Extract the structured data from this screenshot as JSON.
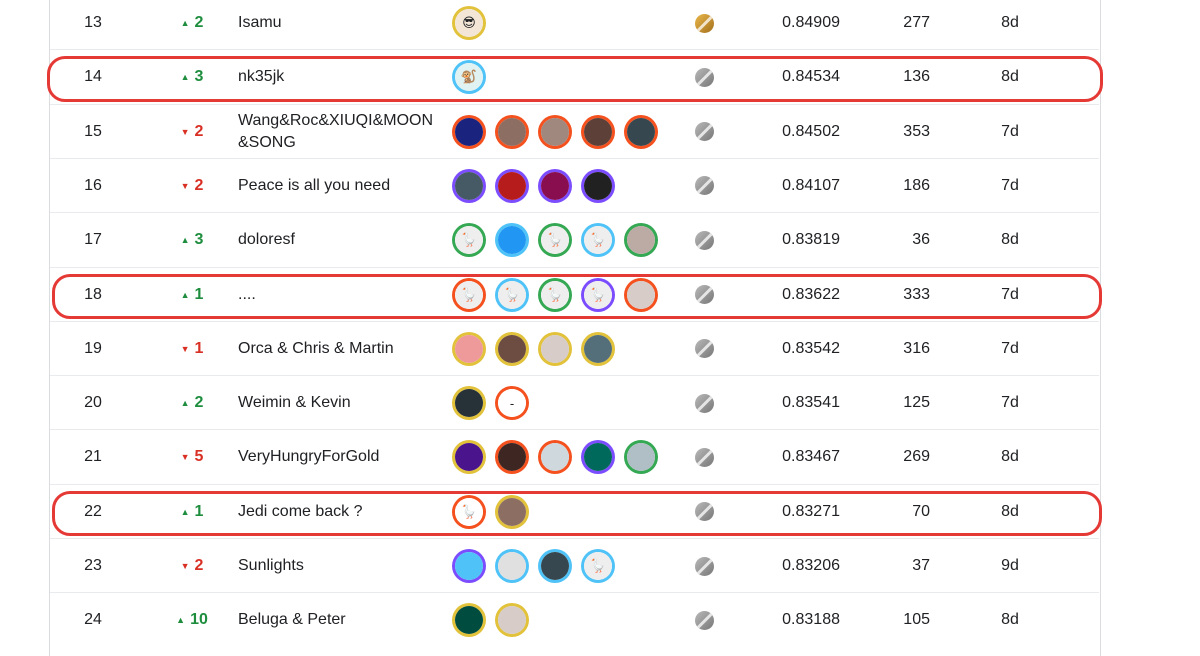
{
  "colors": {
    "up": "#1e8e3e",
    "down": "#d93025",
    "highlight": "#e53935",
    "ring_red": "#f4511e",
    "ring_blue": "#4fc3f7",
    "ring_green": "#34a853",
    "ring_purple": "#7c4dff",
    "ring_gold": "#e2c23a"
  },
  "medal_icons": {
    "gold": "gold-medal-icon",
    "silver": "silver-medal-icon"
  },
  "rows": [
    {
      "rank": "13",
      "delta": "2",
      "dir": "up",
      "name": "Isamu",
      "medal": "gold",
      "score": "0.84909",
      "entries": "277",
      "last": "8d",
      "highlighted": false,
      "avatars": [
        {
          "ring": "#e2c23a",
          "fill": "#f3e6d6",
          "icon": "face-avatar"
        }
      ]
    },
    {
      "rank": "14",
      "delta": "3",
      "dir": "up",
      "name": "nk35jk",
      "medal": "silver",
      "score": "0.84534",
      "entries": "136",
      "last": "8d",
      "highlighted": true,
      "avatars": [
        {
          "ring": "#4fc3f7",
          "fill": "#e0f2f1",
          "icon": "monkey-avatar"
        }
      ]
    },
    {
      "rank": "15",
      "delta": "2",
      "dir": "down",
      "name": "Wang&Roc&XIUQI&MOON&SONG",
      "medal": "silver",
      "score": "0.84502",
      "entries": "353",
      "last": "7d",
      "highlighted": false,
      "avatars": [
        {
          "ring": "#f4511e",
          "fill": "#1a237e",
          "icon": "photo-avatar"
        },
        {
          "ring": "#f4511e",
          "fill": "#8d6e63",
          "icon": "photo-avatar"
        },
        {
          "ring": "#f4511e",
          "fill": "#a1887f",
          "icon": "photo-avatar"
        },
        {
          "ring": "#f4511e",
          "fill": "#5d4037",
          "icon": "photo-avatar"
        },
        {
          "ring": "#f4511e",
          "fill": "#37474f",
          "icon": "photo-avatar"
        }
      ]
    },
    {
      "rank": "16",
      "delta": "2",
      "dir": "down",
      "name": "Peace is all you need",
      "medal": "silver",
      "score": "0.84107",
      "entries": "186",
      "last": "7d",
      "highlighted": false,
      "avatars": [
        {
          "ring": "#7c4dff",
          "fill": "#455a64",
          "icon": "photo-avatar"
        },
        {
          "ring": "#7c4dff",
          "fill": "#b71c1c",
          "icon": "photo-avatar"
        },
        {
          "ring": "#7c4dff",
          "fill": "#880e4f",
          "icon": "photo-avatar"
        },
        {
          "ring": "#7c4dff",
          "fill": "#212121",
          "icon": "photo-avatar"
        }
      ]
    },
    {
      "rank": "17",
      "delta": "3",
      "dir": "up",
      "name": "doloresf",
      "medal": "silver",
      "score": "0.83819",
      "entries": "36",
      "last": "8d",
      "highlighted": false,
      "avatars": [
        {
          "ring": "#34a853",
          "fill": "#eeeeee",
          "icon": "goose-avatar"
        },
        {
          "ring": "#4fc3f7",
          "fill": "#2196f3",
          "icon": "photo-avatar"
        },
        {
          "ring": "#34a853",
          "fill": "#eeeeee",
          "icon": "goose-avatar"
        },
        {
          "ring": "#4fc3f7",
          "fill": "#eeeeee",
          "icon": "goose-avatar"
        },
        {
          "ring": "#34a853",
          "fill": "#bcaaa4",
          "icon": "photo-avatar"
        }
      ]
    },
    {
      "rank": "18",
      "delta": "1",
      "dir": "up",
      "name": "....",
      "medal": "silver",
      "score": "0.83622",
      "entries": "333",
      "last": "7d",
      "highlighted": true,
      "avatars": [
        {
          "ring": "#f4511e",
          "fill": "#eeeeee",
          "icon": "goose-avatar"
        },
        {
          "ring": "#4fc3f7",
          "fill": "#eeeeee",
          "icon": "goose-avatar"
        },
        {
          "ring": "#34a853",
          "fill": "#eeeeee",
          "icon": "goose-avatar"
        },
        {
          "ring": "#7c4dff",
          "fill": "#eeeeee",
          "icon": "goose-avatar"
        },
        {
          "ring": "#f4511e",
          "fill": "#d7ccc8",
          "icon": "photo-avatar"
        }
      ]
    },
    {
      "rank": "19",
      "delta": "1",
      "dir": "down",
      "name": "Orca & Chris & Martin",
      "medal": "silver",
      "score": "0.83542",
      "entries": "316",
      "last": "7d",
      "highlighted": false,
      "avatars": [
        {
          "ring": "#e2c23a",
          "fill": "#ef9a9a",
          "icon": "photo-avatar"
        },
        {
          "ring": "#e2c23a",
          "fill": "#6d4c41",
          "icon": "photo-avatar"
        },
        {
          "ring": "#e2c23a",
          "fill": "#d7ccc8",
          "icon": "photo-avatar"
        },
        {
          "ring": "#e2c23a",
          "fill": "#546e7a",
          "icon": "photo-avatar"
        }
      ]
    },
    {
      "rank": "20",
      "delta": "2",
      "dir": "up",
      "name": "Weimin & Kevin",
      "medal": "silver",
      "score": "0.83541",
      "entries": "125",
      "last": "7d",
      "highlighted": false,
      "avatars": [
        {
          "ring": "#e2c23a",
          "fill": "#263238",
          "icon": "photo-avatar"
        },
        {
          "ring": "#f4511e",
          "fill": "#ffffff",
          "icon": "dash-avatar"
        }
      ]
    },
    {
      "rank": "21",
      "delta": "5",
      "dir": "down",
      "name": "VeryHungryForGold",
      "medal": "silver",
      "score": "0.83467",
      "entries": "269",
      "last": "8d",
      "highlighted": false,
      "avatars": [
        {
          "ring": "#e2c23a",
          "fill": "#4a148c",
          "icon": "photo-avatar"
        },
        {
          "ring": "#f4511e",
          "fill": "#3e2723",
          "icon": "photo-avatar"
        },
        {
          "ring": "#f4511e",
          "fill": "#cfd8dc",
          "icon": "photo-avatar"
        },
        {
          "ring": "#7c4dff",
          "fill": "#00695c",
          "icon": "photo-avatar"
        },
        {
          "ring": "#34a853",
          "fill": "#b0bec5",
          "icon": "photo-avatar"
        }
      ]
    },
    {
      "rank": "22",
      "delta": "1",
      "dir": "up",
      "name": "Jedi come back ?",
      "medal": "silver",
      "score": "0.83271",
      "entries": "70",
      "last": "8d",
      "highlighted": true,
      "avatars": [
        {
          "ring": "#f4511e",
          "fill": "#ffffff",
          "icon": "goose-avatar"
        },
        {
          "ring": "#e2c23a",
          "fill": "#8d6e63",
          "icon": "photo-avatar"
        }
      ]
    },
    {
      "rank": "23",
      "delta": "2",
      "dir": "down",
      "name": "Sunlights",
      "medal": "silver",
      "score": "0.83206",
      "entries": "37",
      "last": "9d",
      "highlighted": false,
      "avatars": [
        {
          "ring": "#7c4dff",
          "fill": "#4fc3f7",
          "icon": "photo-avatar"
        },
        {
          "ring": "#4fc3f7",
          "fill": "#e0e0e0",
          "icon": "photo-avatar"
        },
        {
          "ring": "#4fc3f7",
          "fill": "#37474f",
          "icon": "photo-avatar"
        },
        {
          "ring": "#4fc3f7",
          "fill": "#eeeeee",
          "icon": "goose-avatar"
        }
      ]
    },
    {
      "rank": "24",
      "delta": "10",
      "dir": "up",
      "name": "Beluga & Peter",
      "medal": "silver",
      "score": "0.83188",
      "entries": "105",
      "last": "8d",
      "highlighted": false,
      "avatars": [
        {
          "ring": "#e2c23a",
          "fill": "#004d40",
          "icon": "photo-avatar"
        },
        {
          "ring": "#e2c23a",
          "fill": "#d7ccc8",
          "icon": "photo-avatar"
        }
      ]
    }
  ]
}
